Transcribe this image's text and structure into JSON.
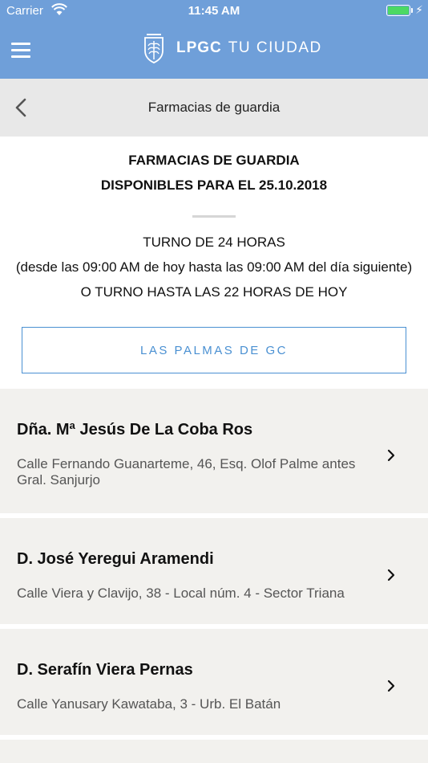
{
  "status_bar": {
    "carrier": "Carrier",
    "time": "11:45 AM",
    "battery_color": "#4cd964"
  },
  "header": {
    "brand_bold": "LPGC",
    "brand_light": "TU CIUDAD",
    "background": "#6f9fd9",
    "icons": [
      "menu-icon",
      "brand-logo"
    ]
  },
  "subheader": {
    "title": "Farmacias de guardia",
    "back_icon": "chevron-left-icon"
  },
  "intro": {
    "heading_line1": "FARMACIAS DE GUARDIA",
    "heading_line2": "DISPONIBLES PARA EL 25.10.2018",
    "line1": "TURNO DE 24 HORAS",
    "line2": "(desde las 09:00 AM de hoy hasta las 09:00 AM del día siguiente)",
    "line3": "O TURNO HASTA LAS 22 HORAS DE HOY"
  },
  "location_button": {
    "label": "LAS PALMAS DE GC",
    "accent": "#4a90d2"
  },
  "pharmacies": [
    {
      "name": "Dña. Mª Jesús De La Coba Ros",
      "address": "Calle Fernando Guanarteme, 46, Esq. Olof Palme antes Gral. Sanjurjo"
    },
    {
      "name": "D. José Yeregui Aramendi",
      "address": "Calle Viera y Clavijo, 38 - Local núm. 4 - Sector Triana"
    },
    {
      "name": "D. Serafín Viera Pernas",
      "address": "Calle Yanusary Kawataba, 3 - Urb. El Batán"
    }
  ]
}
